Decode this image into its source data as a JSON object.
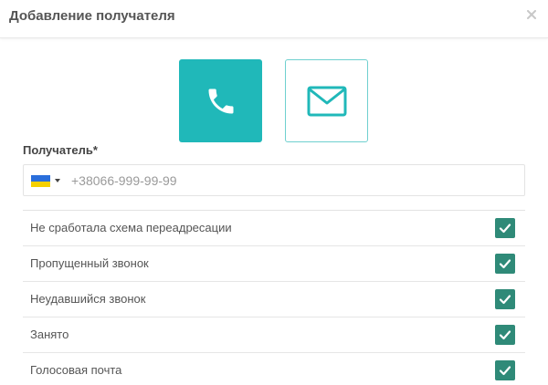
{
  "dialog": {
    "title": "Добавление получателя",
    "close_icon": "close-icon"
  },
  "channels": {
    "phone": {
      "icon": "phone-icon",
      "selected": true,
      "color": "#20b8b9"
    },
    "email": {
      "icon": "envelope-icon",
      "selected": false,
      "color": "#20b8b9"
    }
  },
  "recipient": {
    "label": "Получатель*",
    "country_flag": "ukraine-flag-icon",
    "placeholder": "+38066-999-99-99",
    "value": ""
  },
  "options": [
    {
      "label": "Не сработала схема переадресации",
      "checked": true
    },
    {
      "label": "Пропущенный звонок",
      "checked": true
    },
    {
      "label": "Неудавшийся звонок",
      "checked": true
    },
    {
      "label": "Занято",
      "checked": true
    },
    {
      "label": "Голосовая почта",
      "checked": true
    }
  ],
  "colors": {
    "accent": "#20b8b9",
    "checkbox": "#2f8a78"
  }
}
